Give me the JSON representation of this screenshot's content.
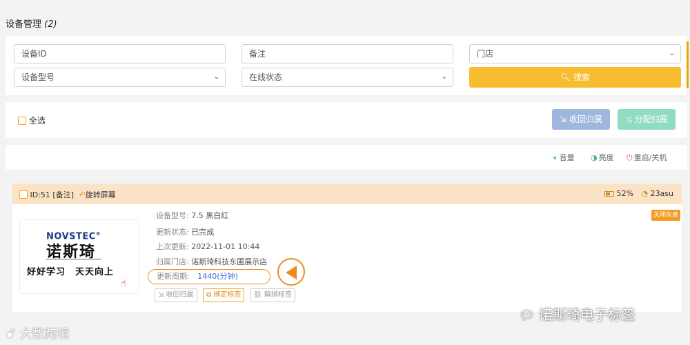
{
  "page": {
    "title": "设备管理",
    "count": "(2)"
  },
  "filters": {
    "device_id_placeholder": "设备ID",
    "remark_placeholder": "备注",
    "store_placeholder": "门店",
    "model_placeholder": "设备型号",
    "online_placeholder": "在线状态",
    "search_label": "搜索"
  },
  "select_bar": {
    "select_all": "全选",
    "recover_label": "收回归属",
    "assign_label": "分配归属"
  },
  "toolbar": {
    "volume": "音量",
    "brightness": "亮度",
    "restart": "重启/关机"
  },
  "device": {
    "header_id": "ID:51 [备注]",
    "rotate": "旋转屏幕",
    "battery": "52%",
    "signal": "23asu",
    "close_gray": "关闭灰度",
    "screen": {
      "brand_en": "NOVSTEC",
      "brand_cn": "诺斯琦",
      "slogan": "好好学习　天天向上"
    },
    "info": [
      {
        "label": "设备型号:",
        "value": "7.5 黑白红"
      },
      {
        "label": "更新状态:",
        "value": "已完成"
      },
      {
        "label": "上次更新:",
        "value": "2022-11-01 10:44"
      },
      {
        "label": "归属门店:",
        "value": "诺斯琦科技东圃展示店"
      }
    ],
    "period_label": "更新周期:",
    "period_value": "1440(分钟)",
    "actions": {
      "recover": "收回归属",
      "bind": "绑定标签",
      "unbind": "解绑标签"
    }
  },
  "watermarks": {
    "left": "大数跨境",
    "right": "诺斯琦电子标签"
  },
  "colors": {
    "accent": "#f7bd2e",
    "orange": "#f08a1e",
    "recover": "#9fb6df",
    "assign": "#8fdcc1"
  }
}
